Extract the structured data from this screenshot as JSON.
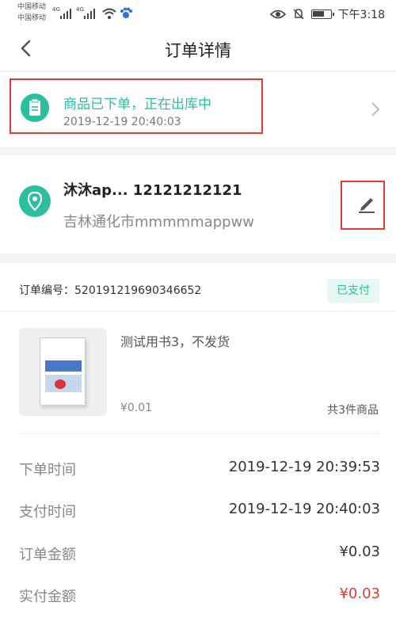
{
  "status_bar": {
    "carrier_1": "中国移动",
    "carrier_2": "中国移动",
    "network_1": "4G",
    "network_2": "4G",
    "time": "下午3:18",
    "icons": [
      "eye-icon",
      "mute-bell-icon",
      "battery-icon",
      "wifi-icon",
      "baidu-paw-icon"
    ]
  },
  "nav": {
    "title": "订单详情"
  },
  "order_status": {
    "title": "商品已下单，正在出库中",
    "time": "2019-12-19 20:40:03"
  },
  "address": {
    "name_phone": "沐沐ap...  12121212121",
    "detail": "吉林通化市mmmmmappww"
  },
  "order": {
    "number_label": "订单编号：",
    "number": "520191219690346652",
    "badge": "已支付",
    "product": {
      "title": "测试用书3，不发货",
      "price": "¥0.01",
      "count": "共3件商品"
    },
    "details": [
      {
        "label": "下单时间",
        "value": "2019-12-19 20:39:53"
      },
      {
        "label": "支付时间",
        "value": "2019-12-19 20:40:03"
      },
      {
        "label": "订单金额",
        "value": "¥0.03"
      },
      {
        "label": "实付金额",
        "value": "¥0.03"
      }
    ]
  },
  "colors": {
    "accent": "#2bbfa0",
    "highlight": "#e53935",
    "price_red": "#e53935"
  }
}
